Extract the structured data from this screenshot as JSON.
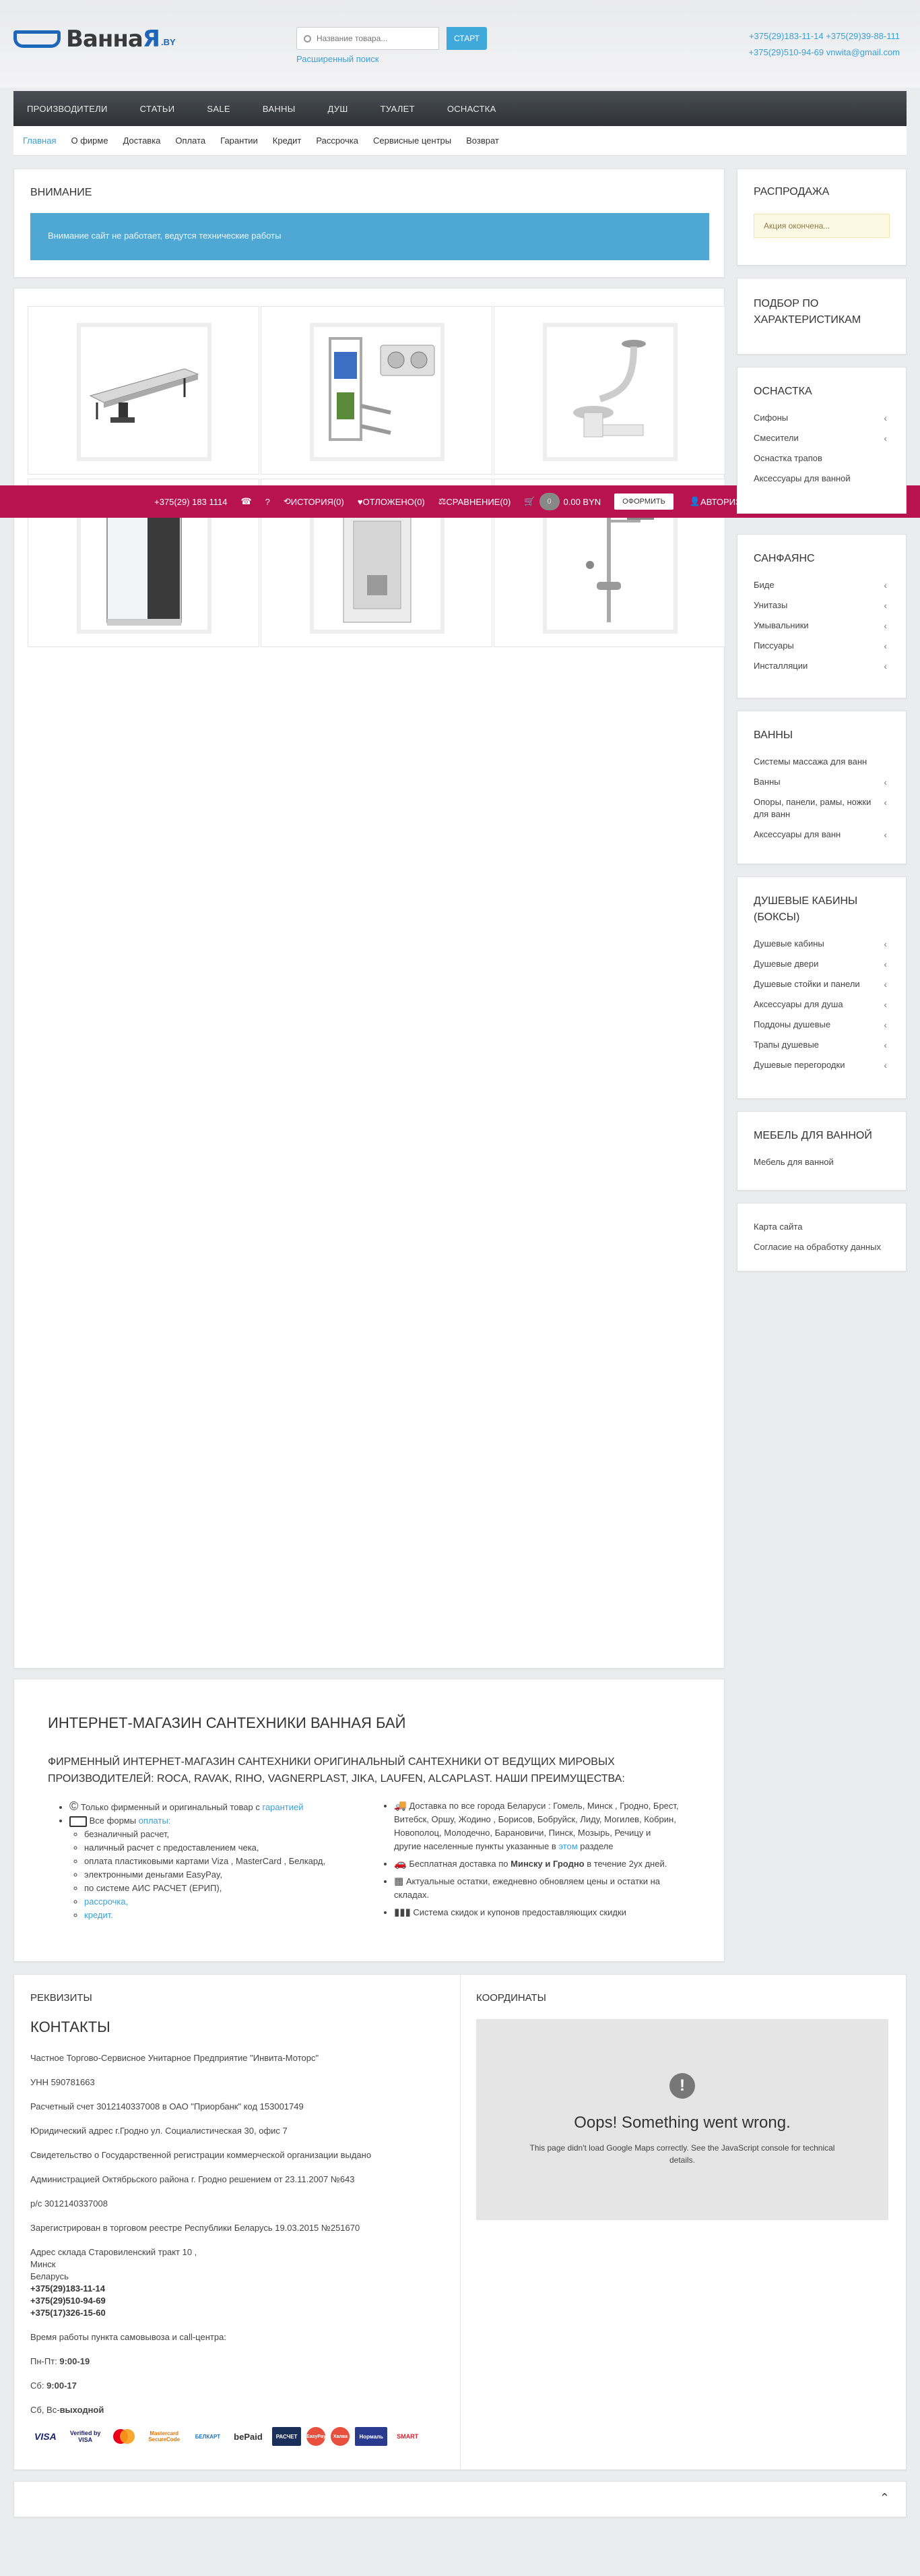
{
  "header": {
    "logo_main": "Ванна",
    "logo_accent": "Я",
    "logo_suffix": ".BY",
    "search_placeholder": "Название товара...",
    "search_button": "СТАРТ",
    "advanced_search": "Расширенный поиск",
    "phone_line": "+375(29)183-11-14  +375(29)39-88-111",
    "phone_email_line": "+375(29)510-94-69   vnwita@gmail.com"
  },
  "main_nav": [
    "ПРОИЗВОДИТЕЛИ",
    "СТАТЬИ",
    "SALE",
    "ВАННЫ",
    "ДУШ",
    "ТУАЛЕТ",
    "ОСНАСТКА"
  ],
  "sub_nav": [
    "Главная",
    "О фирме",
    "Доставка",
    "Оплата",
    "Гарантии",
    "Кредит",
    "Рассрочка",
    "Сервисные центры",
    "Возврат"
  ],
  "attention": {
    "title": "ВНИМАНИЕ",
    "message": "Внимание сайт не работает, ведутся технические работы"
  },
  "products": [
    {
      "name": "drain-channel"
    },
    {
      "name": "installation-system"
    },
    {
      "name": "bath-siphon"
    },
    {
      "name": "shower-cabin"
    },
    {
      "name": "shower-enclosure"
    },
    {
      "name": "shower-column"
    }
  ],
  "toolbar": {
    "phone": "+375(29) 183 1114",
    "history": "ИСТОРИЯ",
    "history_count": "(0)",
    "favorites": "ОТЛОЖЕНО",
    "favorites_count": "(0)",
    "compare": "СРАВНЕНИЕ",
    "compare_count": "(0)",
    "cart_count": "0",
    "cart_total": "0.00 BYN",
    "order_button": "ОФОРМИТЬ",
    "login": "АВТОРИЗАЦИЯ"
  },
  "sidebar": {
    "sale_title": "РАСПРОДАЖА",
    "sale_note": "Акция окончена...",
    "filter_title": "ПОДБОР ПО ХАРАКТЕРИСТИКАМ",
    "sections": [
      {
        "title": "ОСНАСТКА",
        "items": [
          {
            "label": "Сифоны",
            "chev": true
          },
          {
            "label": "Смесители",
            "chev": true
          },
          {
            "label": "Оснастка трапов",
            "chev": false
          },
          {
            "label": "Аксессуары для ванной",
            "chev": false
          }
        ]
      },
      {
        "title": "САНФАЯНС",
        "items": [
          {
            "label": "Биде",
            "chev": true
          },
          {
            "label": "Унитазы",
            "chev": true
          },
          {
            "label": "Умывальники",
            "chev": true
          },
          {
            "label": "Писсуары",
            "chev": true
          },
          {
            "label": "Инсталляции",
            "chev": true
          }
        ]
      },
      {
        "title": "ВАННЫ",
        "items": [
          {
            "label": "Системы массажа для ванн",
            "chev": false
          },
          {
            "label": "Ванны",
            "chev": true
          },
          {
            "label": "Опоры, панели, рамы, ножки для ванн",
            "chev": true
          },
          {
            "label": "Аксессуары для ванн",
            "chev": true
          }
        ]
      },
      {
        "title": "ДУШЕВЫЕ КАБИНЫ (БОКСЫ)",
        "items": [
          {
            "label": "Душевые кабины",
            "chev": true
          },
          {
            "label": "Душевые двери",
            "chev": true
          },
          {
            "label": "Душевые стойки и панели",
            "chev": true
          },
          {
            "label": "Аксессуары для душа",
            "chev": true
          },
          {
            "label": "Поддоны душевые",
            "chev": true
          },
          {
            "label": "Трапы душевые",
            "chev": true
          },
          {
            "label": "Душевые перегородки",
            "chev": true
          }
        ]
      },
      {
        "title": "МЕБЕЛЬ ДЛЯ ВАННОЙ",
        "items": [
          {
            "label": "Мебель для ванной",
            "chev": false
          }
        ]
      }
    ],
    "links": [
      "Карта сайта",
      "Согласие на обработку данных"
    ]
  },
  "about": {
    "title": "ИНТЕРНЕТ-МАГАЗИН САНТЕХНИКИ ВАННАЯ БАЙ",
    "subtitle": "ФИРМЕННЫЙ ИНТЕРНЕТ-МАГАЗИН САНТЕХНИКИ ОРИГИНАЛЬНЫЙ САНТЕХНИКИ ОТ ВЕДУЩИХ МИРОВЫХ ПРОИЗВОДИТЕЛЕЙ: ROCA, RAVAK, RIHO, VAGNERPLAST, JIKA, LAUFEN, ALCAPLAST. НАШИ ПРЕИМУЩЕСТВА:",
    "left": {
      "original_text": "Только фирменный и оригинальный товар с ",
      "original_link": "гарантией",
      "payment_text": "Все формы ",
      "payment_link": "оплаты:",
      "payment_items": [
        "безналичный расчет,",
        "наличный расчет с предоставлением чека,",
        "оплата пластиковыми картами Viza , MasterCard , Белкард,",
        "электронными деньгами EasyPay,",
        "по системе АИС РАСЧЕТ (ЕРИП),"
      ],
      "installment_link": "рассрочка,",
      "credit_link": "кредит."
    },
    "right": {
      "delivery_text": "Доставка по все города Беларуси : Гомель, Минск , Гродно, Брест, Витебск, Оршу, Жодино , Борисов, Бобруйск, Лиду, Могилев, Кобрин, Новополоц, Молодечно, Барановичи, Пинск, Мозырь, Речицу и другие населенные пункты указанные в ",
      "delivery_link": "этом",
      "delivery_tail": " разделе",
      "free_delivery_pre": "Бесплатная доставка по ",
      "free_delivery_bold": "Минску и Гродно",
      "free_delivery_post": " в течение 2ух дней.",
      "stock_text": "Актуальные остатки, ежедневно обновляем цены и остатки на складах.",
      "discount_text": "Система скидок и купонов предоставляющих скидки"
    }
  },
  "footer": {
    "requisites_title": "РЕКВИЗИТЫ",
    "contacts_title": "КОНТАКТЫ",
    "lines": [
      "Частное Торгово-Сервисное Унитарное Предприятие \"Инвита-Моторс\"",
      "УНН 590781663",
      "Расчетный счет 3012140337008 в ОАО \"Приорбанк\" код 153001749",
      "Юридический адрес г.Гродно ул. Социалистическая 30, офис 7",
      "Свидетельство о Государственной регистрации коммерческой организации выдано",
      "Администрацией Октябрьского района г. Гродно решением от 23.11.2007 №643",
      "р/с 3012140337008",
      "Зарегистрирован в торговом реестре Республики Беларусь 19.03.2015 №251670"
    ],
    "address_lines": [
      "Адрес склада Старовиленский тракт 10 ,",
      "Минск",
      "Беларусь"
    ],
    "phones": [
      "+375(29)183-11-14",
      "+375(29)510-94-69",
      "+375(17)326-15-60"
    ],
    "hours_title": "Время работы пункта самовывоза и call-центра:",
    "hours": [
      {
        "day": "Пн-Пт: ",
        "time": "9:00-19"
      },
      {
        "day": "Сб: ",
        "time": "9:00-17"
      },
      {
        "day": "Сб, Вс-",
        "time": "выходной"
      }
    ],
    "payment_logos": [
      "VISA",
      "Verified by VISA",
      "mastercard",
      "Mastercard SecureCode",
      "БЕЛКАРТ",
      "bePaid",
      "РАСЧЕТ",
      "EasyPay",
      "Халва",
      "Нормаль",
      "SMART"
    ],
    "coords_title": "КООРДИНАТЫ",
    "map_error_title": "Oops! Something went wrong.",
    "map_error_text": "This page didn't load Google Maps correctly. See the JavaScript console for technical details.",
    "map_error_icon": "!"
  },
  "colors": {
    "accent": "#3a9fd6",
    "toolbar": "#b8124f",
    "nav": "#3a3e43",
    "logo": "#1e66b8"
  }
}
